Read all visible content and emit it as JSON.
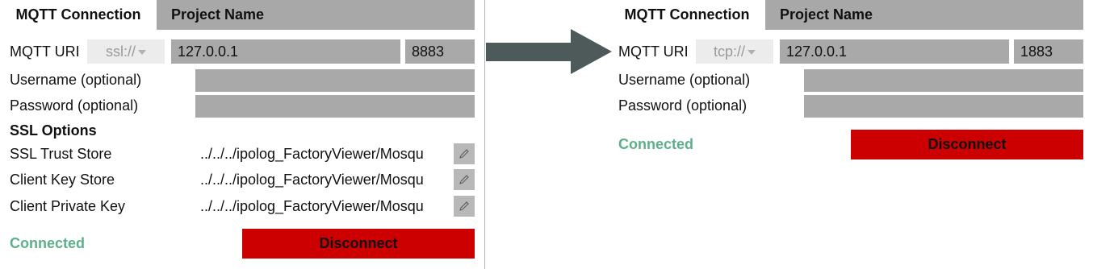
{
  "left": {
    "tabs": {
      "active": "MQTT Connection",
      "inactive": "Project Name"
    },
    "mqtt_uri_label": "MQTT URI",
    "scheme": "ssl://",
    "host": "127.0.0.1",
    "port": "8883",
    "username_label": "Username (optional)",
    "password_label": "Password (optional)",
    "ssl_options_label": "SSL Options",
    "trust_store_label": "SSL Trust Store",
    "trust_store_path": "../../../ipolog_FactoryViewer/Mosqu",
    "key_store_label": "Client Key Store",
    "key_store_path": "../../../ipolog_FactoryViewer/Mosqu",
    "private_key_label": "Client Private Key",
    "private_key_path": "../../../ipolog_FactoryViewer/Mosqu",
    "status": "Connected",
    "disconnect_label": "Disconnect"
  },
  "right": {
    "tabs": {
      "active": "MQTT Connection",
      "inactive": "Project Name"
    },
    "mqtt_uri_label": "MQTT URI",
    "scheme": "tcp://",
    "host": "127.0.0.1",
    "port": "1883",
    "username_label": "Username (optional)",
    "password_label": "Password (optional)",
    "status": "Connected",
    "disconnect_label": "Disconnect"
  },
  "colors": {
    "accent_connected": "#5cb08a",
    "disconnect_button": "#cc0000",
    "field_background": "#a9a9a9",
    "tab_bar": "#a8a8a8",
    "arrow": "#4d5a59"
  },
  "icons": {
    "edit": "pencil-icon",
    "dropdown": "chevron-down-icon",
    "arrow": "right-arrow-icon"
  }
}
